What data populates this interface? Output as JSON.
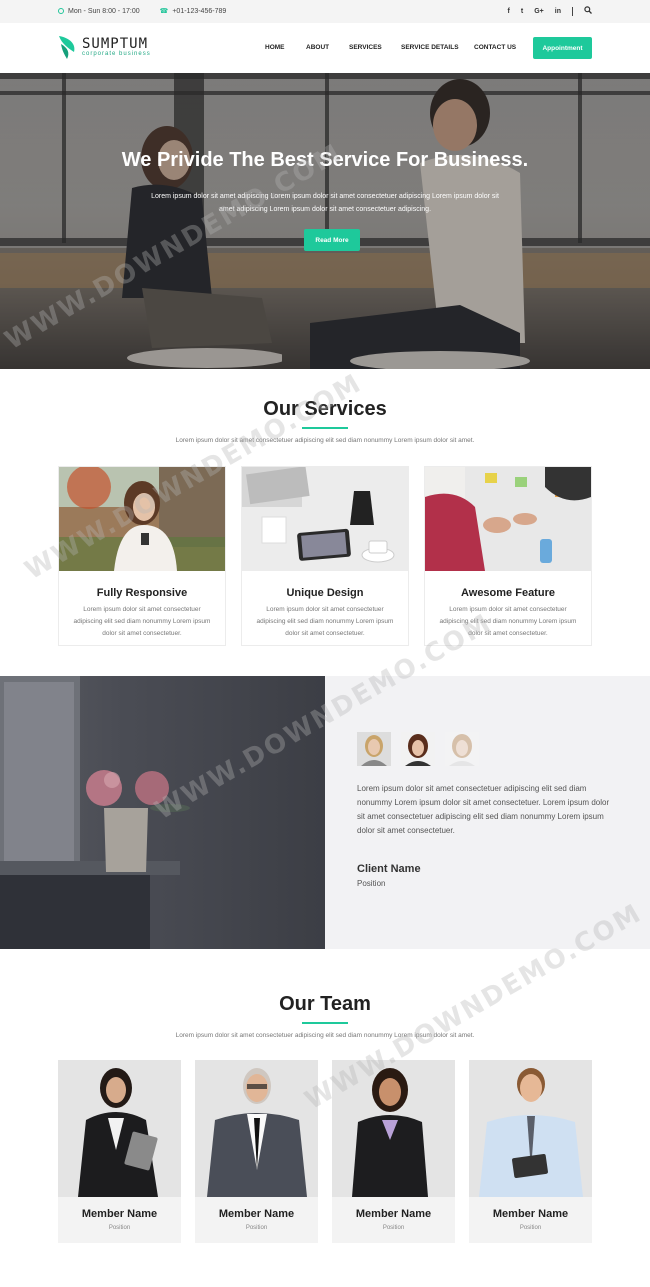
{
  "topbar": {
    "hours": "Mon - Sun 8:00 - 17:00",
    "phone": "+01-123-456-789",
    "social": [
      "f",
      "t",
      "G+",
      "in"
    ]
  },
  "header": {
    "logo_name": "SUMPTUM",
    "logo_tagline": "corporate business",
    "nav": [
      "HOME",
      "ABOUT",
      "SERVICES",
      "SERVICE DETAILS",
      "CONTACT US"
    ],
    "cta": "Appointment"
  },
  "hero": {
    "title": "We Privide The Best Service For Business.",
    "text": "Lorem ipsum dolor sit amet adipiscing Lorem ipsum dolor sit amet consectetuer adipiscing Lorem ipsum dolor sit amet adipiscing Lorem ipsum dolor sit amet consectetuer adipiscing.",
    "button": "Read More"
  },
  "services": {
    "title": "Our Services",
    "subtitle": "Lorem ipsum dolor sit amet consectetuer adipiscing elit sed diam nonummy Lorem ipsum dolor sit amet.",
    "items": [
      {
        "title": "Fully Responsive",
        "text": "Lorem ipsum dolor sit amet consectetuer adipiscing elit sed diam nonummy Lorem ipsum dolor sit amet consectetuer."
      },
      {
        "title": "Unique Design",
        "text": "Lorem ipsum dolor sit amet consectetuer adipiscing elit sed diam nonummy Lorem ipsum dolor sit amet consectetuer."
      },
      {
        "title": "Awesome Feature",
        "text": "Lorem ipsum dolor sit amet consectetuer adipiscing elit sed diam nonummy Lorem ipsum dolor sit amet consectetuer."
      }
    ]
  },
  "testimonial": {
    "quote": "Lorem ipsum dolor sit amet consectetuer adipiscing elit sed diam nonummy Lorem ipsum dolor sit amet consectetuer. Lorem ipsum dolor sit amet consectetuer adipiscing elit sed diam nonummy Lorem ipsum dolor sit amet consectetuer.",
    "client_name": "Client Name",
    "client_position": "Position"
  },
  "team": {
    "title": "Our Team",
    "subtitle": "Lorem ipsum dolor sit amet consectetuer adipiscing elit sed diam nonummy Lorem ipsum dolor sit amet.",
    "members": [
      {
        "name": "Member Name",
        "position": "Position"
      },
      {
        "name": "Member Name",
        "position": "Position"
      },
      {
        "name": "Member Name",
        "position": "Position"
      },
      {
        "name": "Member Name",
        "position": "Position"
      }
    ]
  },
  "watermark": "WWW.DOWNDEMO.COM",
  "colors": {
    "accent": "#1ec99b",
    "topbar_bg": "#f4f4f4",
    "testimonial_bg": "#f2f2f4"
  }
}
